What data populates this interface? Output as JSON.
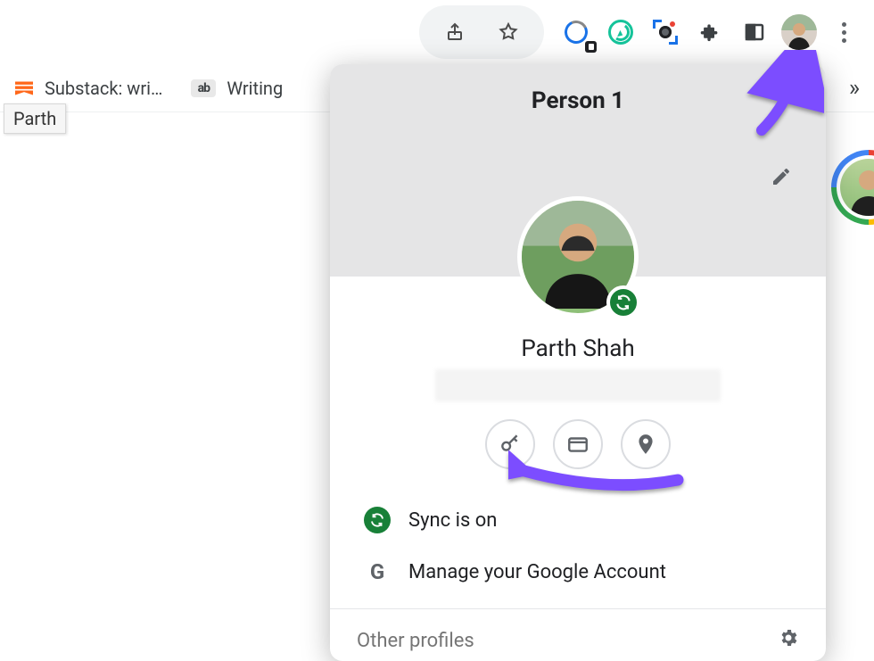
{
  "toolbar": {
    "icons": {
      "share": "share-icon",
      "star": "star-icon",
      "onetab": "onetab-icon",
      "grammarly": "grammarly-icon",
      "screenshot": "screenshot-icon",
      "extensions": "puzzle-icon",
      "sidepanel": "panel-icon",
      "profile": "profile-avatar",
      "menu": "kebab-menu"
    }
  },
  "bookmarks": {
    "items": [
      {
        "label": "Substack: wri…"
      },
      {
        "label": "Writing"
      }
    ],
    "overflow": "»",
    "tooltip": "Parth"
  },
  "profile_popup": {
    "title": "Person 1",
    "name": "Parth Shah",
    "chips": {
      "passwords": "key-icon",
      "payments": "card-icon",
      "addresses": "pin-icon"
    },
    "options": [
      {
        "icon": "sync-on-icon",
        "label": "Sync is on"
      },
      {
        "icon": "google-g-icon",
        "label": "Manage your Google Account"
      }
    ],
    "footer": {
      "label": "Other profiles",
      "settings": "gear-icon"
    }
  }
}
